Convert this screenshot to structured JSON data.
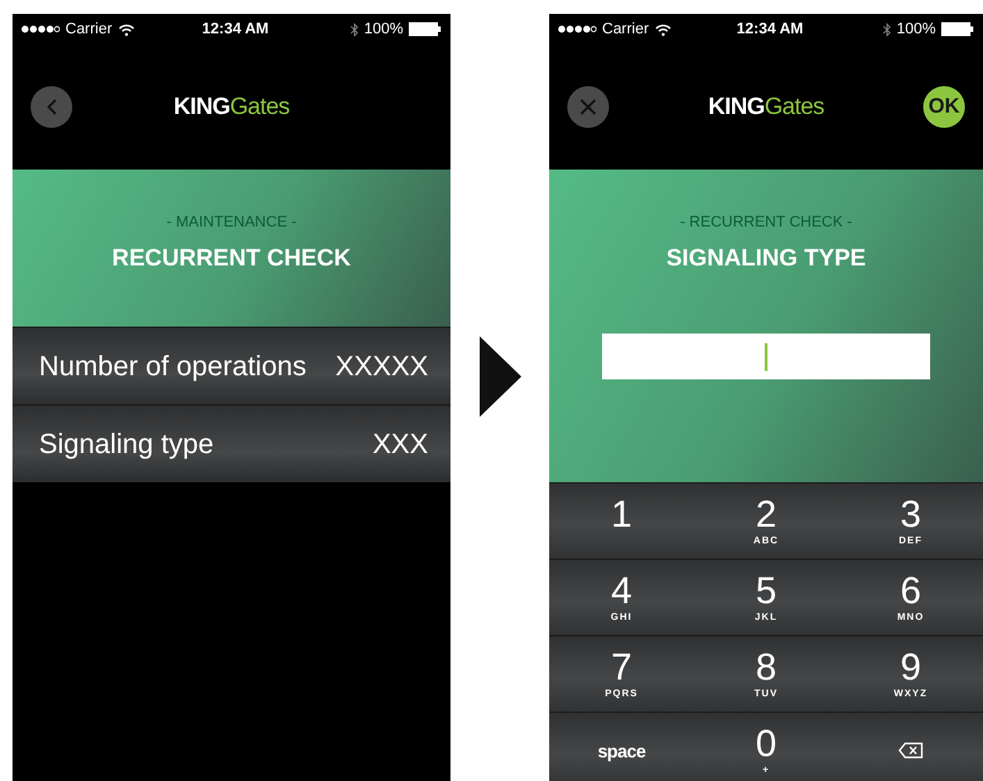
{
  "screens": [
    {
      "status_bar": {
        "carrier": "Carrier",
        "time": "12:34 AM",
        "battery": "100%"
      },
      "nav": {
        "left_button": {
          "kind": "back"
        },
        "brand": {
          "strong": "KING",
          "light": "Gates"
        }
      },
      "header": {
        "overline": "- MAINTENANCE -",
        "title": "RECURRENT CHECK"
      },
      "rows": [
        {
          "label": "Number of operations",
          "value": "XXXXX"
        },
        {
          "label": "Signaling type",
          "value": "XXX"
        }
      ]
    },
    {
      "status_bar": {
        "carrier": "Carrier",
        "time": "12:34 AM",
        "battery": "100%"
      },
      "nav": {
        "left_button": {
          "kind": "close"
        },
        "brand": {
          "strong": "KING",
          "light": "Gates"
        },
        "right_button": "OK"
      },
      "header": {
        "overline": "- RECURRENT CHECK -",
        "title": "SIGNALING TYPE"
      },
      "input": {
        "focused": true
      },
      "keypad_rows": [
        [
          {
            "kind": "digit",
            "digit": "1"
          },
          {
            "kind": "digit",
            "digit": "2",
            "letters": "ABC"
          },
          {
            "kind": "digit",
            "digit": "3",
            "letters": "DEF"
          }
        ],
        [
          {
            "kind": "digit",
            "digit": "4",
            "letters": "GHI"
          },
          {
            "kind": "digit",
            "digit": "5",
            "letters": "JKL"
          },
          {
            "kind": "digit",
            "digit": "6",
            "letters": "MNO"
          }
        ],
        [
          {
            "kind": "digit",
            "digit": "7",
            "letters": "PQRS"
          },
          {
            "kind": "digit",
            "digit": "8",
            "letters": "TUV"
          },
          {
            "kind": "digit",
            "digit": "9",
            "letters": "WXYZ"
          }
        ],
        [
          {
            "kind": "space",
            "label": "space"
          },
          {
            "kind": "digit",
            "digit": "0",
            "letters": "+"
          },
          {
            "kind": "delete"
          }
        ]
      ]
    }
  ]
}
